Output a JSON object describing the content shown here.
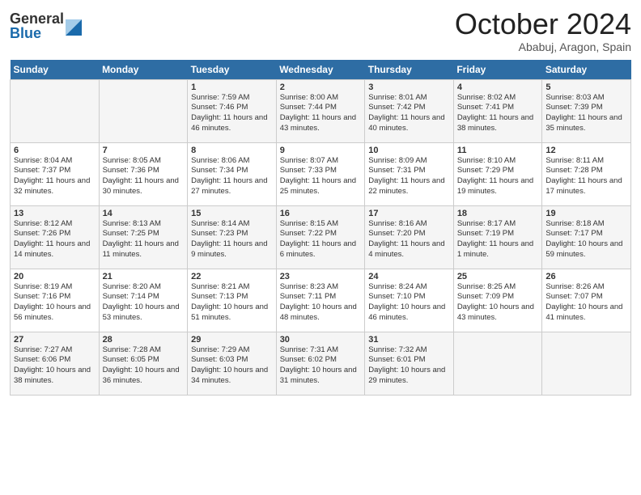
{
  "header": {
    "logo_general": "General",
    "logo_blue": "Blue",
    "title": "October 2024",
    "location": "Ababuj, Aragon, Spain"
  },
  "days_of_week": [
    "Sunday",
    "Monday",
    "Tuesday",
    "Wednesday",
    "Thursday",
    "Friday",
    "Saturday"
  ],
  "weeks": [
    [
      {
        "day": "",
        "info": ""
      },
      {
        "day": "",
        "info": ""
      },
      {
        "day": "1",
        "info": "Sunrise: 7:59 AM\nSunset: 7:46 PM\nDaylight: 11 hours and 46 minutes."
      },
      {
        "day": "2",
        "info": "Sunrise: 8:00 AM\nSunset: 7:44 PM\nDaylight: 11 hours and 43 minutes."
      },
      {
        "day": "3",
        "info": "Sunrise: 8:01 AM\nSunset: 7:42 PM\nDaylight: 11 hours and 40 minutes."
      },
      {
        "day": "4",
        "info": "Sunrise: 8:02 AM\nSunset: 7:41 PM\nDaylight: 11 hours and 38 minutes."
      },
      {
        "day": "5",
        "info": "Sunrise: 8:03 AM\nSunset: 7:39 PM\nDaylight: 11 hours and 35 minutes."
      }
    ],
    [
      {
        "day": "6",
        "info": "Sunrise: 8:04 AM\nSunset: 7:37 PM\nDaylight: 11 hours and 32 minutes."
      },
      {
        "day": "7",
        "info": "Sunrise: 8:05 AM\nSunset: 7:36 PM\nDaylight: 11 hours and 30 minutes."
      },
      {
        "day": "8",
        "info": "Sunrise: 8:06 AM\nSunset: 7:34 PM\nDaylight: 11 hours and 27 minutes."
      },
      {
        "day": "9",
        "info": "Sunrise: 8:07 AM\nSunset: 7:33 PM\nDaylight: 11 hours and 25 minutes."
      },
      {
        "day": "10",
        "info": "Sunrise: 8:09 AM\nSunset: 7:31 PM\nDaylight: 11 hours and 22 minutes."
      },
      {
        "day": "11",
        "info": "Sunrise: 8:10 AM\nSunset: 7:29 PM\nDaylight: 11 hours and 19 minutes."
      },
      {
        "day": "12",
        "info": "Sunrise: 8:11 AM\nSunset: 7:28 PM\nDaylight: 11 hours and 17 minutes."
      }
    ],
    [
      {
        "day": "13",
        "info": "Sunrise: 8:12 AM\nSunset: 7:26 PM\nDaylight: 11 hours and 14 minutes."
      },
      {
        "day": "14",
        "info": "Sunrise: 8:13 AM\nSunset: 7:25 PM\nDaylight: 11 hours and 11 minutes."
      },
      {
        "day": "15",
        "info": "Sunrise: 8:14 AM\nSunset: 7:23 PM\nDaylight: 11 hours and 9 minutes."
      },
      {
        "day": "16",
        "info": "Sunrise: 8:15 AM\nSunset: 7:22 PM\nDaylight: 11 hours and 6 minutes."
      },
      {
        "day": "17",
        "info": "Sunrise: 8:16 AM\nSunset: 7:20 PM\nDaylight: 11 hours and 4 minutes."
      },
      {
        "day": "18",
        "info": "Sunrise: 8:17 AM\nSunset: 7:19 PM\nDaylight: 11 hours and 1 minute."
      },
      {
        "day": "19",
        "info": "Sunrise: 8:18 AM\nSunset: 7:17 PM\nDaylight: 10 hours and 59 minutes."
      }
    ],
    [
      {
        "day": "20",
        "info": "Sunrise: 8:19 AM\nSunset: 7:16 PM\nDaylight: 10 hours and 56 minutes."
      },
      {
        "day": "21",
        "info": "Sunrise: 8:20 AM\nSunset: 7:14 PM\nDaylight: 10 hours and 53 minutes."
      },
      {
        "day": "22",
        "info": "Sunrise: 8:21 AM\nSunset: 7:13 PM\nDaylight: 10 hours and 51 minutes."
      },
      {
        "day": "23",
        "info": "Sunrise: 8:23 AM\nSunset: 7:11 PM\nDaylight: 10 hours and 48 minutes."
      },
      {
        "day": "24",
        "info": "Sunrise: 8:24 AM\nSunset: 7:10 PM\nDaylight: 10 hours and 46 minutes."
      },
      {
        "day": "25",
        "info": "Sunrise: 8:25 AM\nSunset: 7:09 PM\nDaylight: 10 hours and 43 minutes."
      },
      {
        "day": "26",
        "info": "Sunrise: 8:26 AM\nSunset: 7:07 PM\nDaylight: 10 hours and 41 minutes."
      }
    ],
    [
      {
        "day": "27",
        "info": "Sunrise: 7:27 AM\nSunset: 6:06 PM\nDaylight: 10 hours and 38 minutes."
      },
      {
        "day": "28",
        "info": "Sunrise: 7:28 AM\nSunset: 6:05 PM\nDaylight: 10 hours and 36 minutes."
      },
      {
        "day": "29",
        "info": "Sunrise: 7:29 AM\nSunset: 6:03 PM\nDaylight: 10 hours and 34 minutes."
      },
      {
        "day": "30",
        "info": "Sunrise: 7:31 AM\nSunset: 6:02 PM\nDaylight: 10 hours and 31 minutes."
      },
      {
        "day": "31",
        "info": "Sunrise: 7:32 AM\nSunset: 6:01 PM\nDaylight: 10 hours and 29 minutes."
      },
      {
        "day": "",
        "info": ""
      },
      {
        "day": "",
        "info": ""
      }
    ]
  ]
}
